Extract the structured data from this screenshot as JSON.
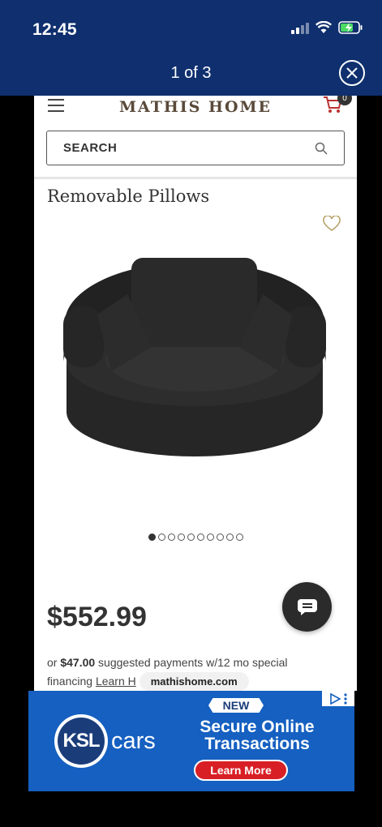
{
  "status_bar": {
    "time": "12:45"
  },
  "viewer": {
    "counter": "1 of 3",
    "close_icon": "close-circle-icon"
  },
  "site": {
    "logo": "MATHIS HOME",
    "cart_count": "0",
    "search_placeholder": "SEARCH"
  },
  "product": {
    "title": "Removable Pillows",
    "image": "black round swivel chair with pillows",
    "gallery_total": 10,
    "gallery_active": 1,
    "price": "$552.99",
    "financing_prefix": "or ",
    "financing_amount": "$47.00",
    "financing_suffix": " suggested payments w/12 mo special",
    "financing_line2": "financing ",
    "learn_link": "Learn H",
    "domain_label": "mathishome.com"
  },
  "ad": {
    "badge": "NEW",
    "brand_mark": "KSL",
    "brand_text": "cars",
    "headline_line1": "Secure Online",
    "headline_line2": "Transactions",
    "cta": "Learn More"
  },
  "colors": {
    "header_bg": "#0f2f6e",
    "ad_bg": "#1560c1",
    "cta_red": "#d81f26",
    "logo_brown": "#5a4a3a"
  }
}
